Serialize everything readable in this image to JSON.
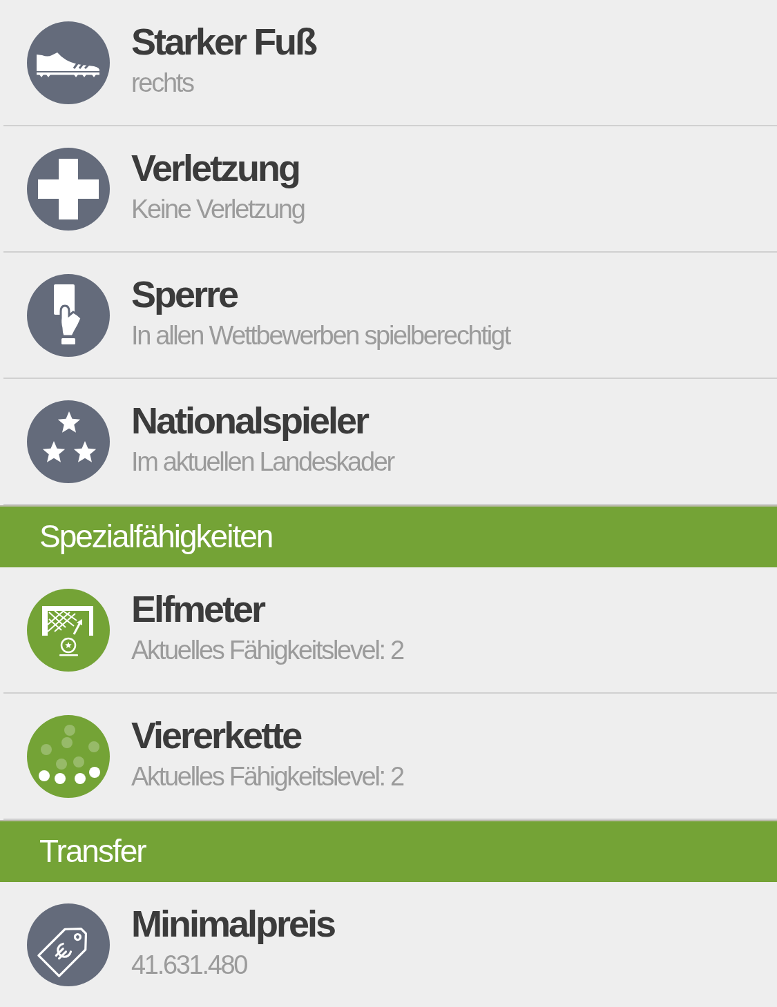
{
  "sections": [
    {
      "items": [
        {
          "kind": "footedness",
          "color": "#646b7b",
          "title": "Starker Fuß",
          "subtitle": "rechts"
        },
        {
          "kind": "injury",
          "color": "#646b7b",
          "title": "Verletzung",
          "subtitle": "Keine Verletzung"
        },
        {
          "kind": "suspension",
          "color": "#646b7b",
          "title": "Sperre",
          "subtitle": "In allen Wettbewerben spielberechtigt"
        },
        {
          "kind": "international",
          "color": "#646b7b",
          "title": "Nationalspieler",
          "subtitle": "Im aktuellen Landeskader"
        }
      ]
    },
    {
      "header": "Spezialfähigkeiten",
      "items": [
        {
          "kind": "penalty",
          "color": "#74a336",
          "title": "Elfmeter",
          "subtitle": "Aktuelles Fähigkeitslevel: 2"
        },
        {
          "kind": "backfour",
          "color": "#74a336",
          "title": "Viererkette",
          "subtitle": "Aktuelles Fähigkeitslevel: 2"
        }
      ]
    },
    {
      "header": "Transfer",
      "items": [
        {
          "kind": "price",
          "color": "#646b7b",
          "title": "Minimalpreis",
          "subtitle": "41.631.480"
        }
      ]
    }
  ]
}
